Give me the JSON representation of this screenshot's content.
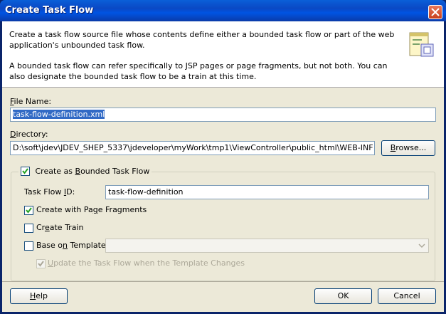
{
  "window": {
    "title": "Create Task Flow"
  },
  "info": {
    "paragraph1": "Create a task flow source file whose contents define either a bounded task flow or part of the web application's unbounded task flow.",
    "paragraph2": "A bounded task flow can refer specifically to JSP pages or page fragments, but not both.  You can also designate the bounded task flow to be a train at this time."
  },
  "file_name": {
    "label_pre": "",
    "label_mnemonic": "F",
    "label_post": "ile Name:",
    "value": "task-flow-definition.xml"
  },
  "directory": {
    "label_pre": "",
    "label_mnemonic": "D",
    "label_post": "irectory:",
    "value": "D:\\soft\\jdev\\JDEV_SHEP_5337\\jdeveloper\\myWork\\tmp1\\ViewController\\public_html\\WEB-INF",
    "browse_pre": "",
    "browse_mnemonic": "B",
    "browse_post": "rowse..."
  },
  "bounded": {
    "label_pre": "Create as ",
    "label_mnemonic": "B",
    "label_post": "ounded Task Flow",
    "checked": true,
    "task_flow_id_label_pre": "Task Flow ",
    "task_flow_id_label_mnemonic": "I",
    "task_flow_id_label_post": "D:",
    "task_flow_id_value": "task-flow-definition",
    "page_fragments_pre": "Create with Pa",
    "page_fragments_mnemonic": "g",
    "page_fragments_post": "e Fragments",
    "create_train_pre": "Cr",
    "create_train_mnemonic": "e",
    "create_train_post": "ate Train",
    "base_template_pre": "Base o",
    "base_template_mnemonic": "n",
    "base_template_post": " Template:",
    "base_template_value": "",
    "update_pre": "",
    "update_mnemonic": "U",
    "update_post": "pdate the Task Flow when the Template Changes"
  },
  "buttons": {
    "help_pre": "",
    "help_mnemonic": "H",
    "help_post": "elp",
    "ok": "OK",
    "cancel": "Cancel"
  },
  "colors": {
    "title_bar": "#0054e3",
    "close_button": "#c8401c",
    "dialog_bg": "#ece9d8",
    "selection": "#316ac5"
  }
}
